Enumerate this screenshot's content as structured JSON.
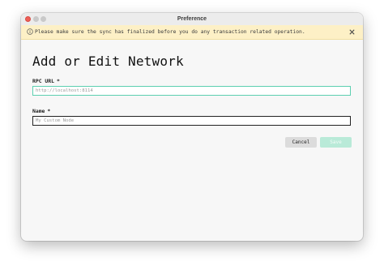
{
  "window": {
    "title": "Preference"
  },
  "banner": {
    "icon": "info-icon",
    "text": "Please make sure the sync has finalized before you do any transaction related operation.",
    "close_icon": "close-icon",
    "background": "#fdf0c6"
  },
  "page": {
    "title": "Add or Edit Network"
  },
  "form": {
    "rpc_url": {
      "label": "RPC URL",
      "required_mark": "*",
      "placeholder": "http://localhost:8114",
      "value": ""
    },
    "name": {
      "label": "Name",
      "required_mark": "*",
      "placeholder": "My Custom Node",
      "value": ""
    }
  },
  "actions": {
    "cancel_label": "Cancel",
    "save_label": "Save",
    "save_enabled": false
  },
  "colors": {
    "accent": "#5ccfb0",
    "save_disabled": "#b9ead8",
    "close_button": "#ee5f57"
  }
}
